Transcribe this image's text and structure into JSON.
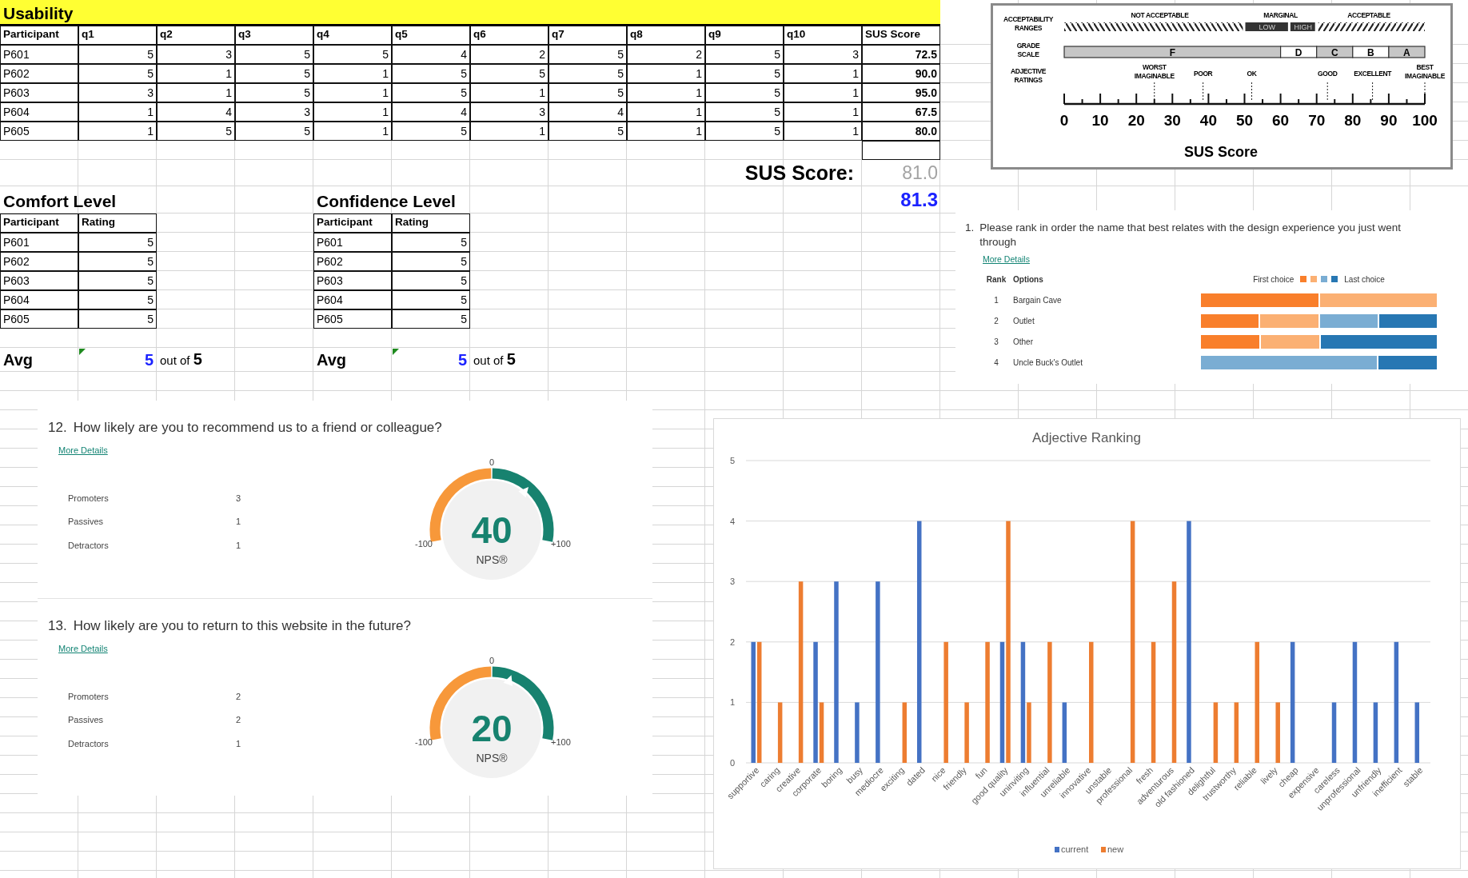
{
  "sheet": {
    "title": "Usability",
    "usability": {
      "columns": [
        "Participant",
        "q1",
        "q2",
        "q3",
        "q4",
        "q5",
        "q6",
        "q7",
        "q8",
        "q9",
        "q10",
        "SUS Score"
      ],
      "rows": [
        {
          "participant": "P601",
          "answers": [
            "5",
            "3",
            "5",
            "5",
            "4",
            "2",
            "5",
            "2",
            "5",
            "3"
          ],
          "sus": "72.5"
        },
        {
          "participant": "P602",
          "answers": [
            "5",
            "1",
            "5",
            "1",
            "5",
            "5",
            "5",
            "1",
            "5",
            "1"
          ],
          "sus": "90.0"
        },
        {
          "participant": "P603",
          "answers": [
            "3",
            "1",
            "5",
            "1",
            "5",
            "1",
            "5",
            "1",
            "5",
            "1"
          ],
          "sus": "95.0"
        },
        {
          "participant": "P604",
          "answers": [
            "1",
            "4",
            "3",
            "1",
            "4",
            "3",
            "4",
            "1",
            "5",
            "1"
          ],
          "sus": "67.5"
        },
        {
          "participant": "P605",
          "answers": [
            "1",
            "5",
            "5",
            "1",
            "5",
            "1",
            "5",
            "1",
            "5",
            "1"
          ],
          "sus": "80.0"
        }
      ]
    },
    "sus_summary": {
      "label": "SUS Score:",
      "raw": "81.0",
      "adjusted": "81.3"
    },
    "tables": [
      {
        "title": "Comfort Level",
        "columns": [
          "Participant",
          "Rating"
        ],
        "rows": [
          {
            "participant": "P601",
            "rating": "5"
          },
          {
            "participant": "P602",
            "rating": "5"
          },
          {
            "participant": "P603",
            "rating": "5"
          },
          {
            "participant": "P604",
            "rating": "5"
          },
          {
            "participant": "P605",
            "rating": "5"
          }
        ],
        "avg": {
          "label": "Avg",
          "value": "5",
          "suffix": "out of **5**"
        }
      },
      {
        "title": "Confidence Level",
        "columns": [
          "Participant",
          "Rating"
        ],
        "rows": [
          {
            "participant": "P601",
            "rating": "5"
          },
          {
            "participant": "P602",
            "rating": "5"
          },
          {
            "participant": "P603",
            "rating": "5"
          },
          {
            "participant": "P604",
            "rating": "5"
          },
          {
            "participant": "P605",
            "rating": "5"
          }
        ],
        "avg": {
          "label": "Avg",
          "value": "5",
          "suffix": "out of **5**"
        }
      }
    ]
  },
  "sus_scale": {
    "row_labels": [
      "ACCEPTABILITY RANGES",
      "GRADE SCALE",
      "ADJECTIVE RATINGS"
    ],
    "ranges": [
      "NOT ACCEPTABLE",
      "MARGINAL",
      "ACCEPTABLE"
    ],
    "marginal_parts": [
      "LOW",
      "HIGH"
    ],
    "grades": [
      "F",
      "D",
      "C",
      "B",
      "A"
    ],
    "adjectives": [
      "WORST IMAGINABLE",
      "POOR",
      "OK",
      "GOOD",
      "EXCELLENT",
      "BEST IMAGINABLE"
    ],
    "ticks": [
      "0",
      "10",
      "20",
      "30",
      "40",
      "50",
      "60",
      "70",
      "80",
      "90",
      "100"
    ],
    "axis_title": "SUS Score"
  },
  "ranking": {
    "number": "1.",
    "question": "Please rank in order the name that best relates with the design experience you just went through",
    "link": "More Details",
    "columns": [
      "Rank",
      "Options"
    ],
    "legend": {
      "first_label": "First choice",
      "last_label": "Last choice",
      "swatches": [
        {
          "color": "#f97f2b"
        },
        {
          "color": "#fbb073"
        },
        {
          "color": "#7aadd3"
        },
        {
          "color": "#2777b3"
        }
      ]
    },
    "options": [
      {
        "rank": "1",
        "name": "Bargain Cave"
      },
      {
        "rank": "2",
        "name": "Outlet"
      },
      {
        "rank": "3",
        "name": "Other"
      },
      {
        "rank": "4",
        "name": "Uncle Buck's Outlet"
      }
    ]
  },
  "nps": [
    {
      "number": "12.",
      "question": "How likely are you to recommend us to a friend or colleague?",
      "link": "More Details",
      "groups": [
        {
          "label": "Promoters",
          "count": "3"
        },
        {
          "label": "Passives",
          "count": "1"
        },
        {
          "label": "Detractors",
          "count": "1"
        }
      ],
      "score": "40",
      "score_label": "NPS®",
      "scale_min": "-100",
      "scale_zero": "0",
      "scale_max": "+100"
    },
    {
      "number": "13.",
      "question": "How likely are you to return to this website in the future?",
      "link": "More Details",
      "groups": [
        {
          "label": "Promoters",
          "count": "2"
        },
        {
          "label": "Passives",
          "count": "2"
        },
        {
          "label": "Detractors",
          "count": "1"
        }
      ],
      "score": "20",
      "score_label": "NPS®",
      "scale_min": "-100",
      "scale_zero": "0",
      "scale_max": "+100"
    }
  ],
  "adjective_chart": {
    "chart_data": {
      "type": "bar",
      "title": "Adjective Ranking",
      "categories": [
        "supportive",
        "caring",
        "creative",
        "corporate",
        "boring",
        "busy",
        "mediocre",
        "exciting",
        "dated",
        "nice",
        "friendly",
        "fun",
        "good quality",
        "uninviting",
        "influential",
        "unreliable",
        "innovative",
        "unstable",
        "professional",
        "fresh",
        "adventurous",
        "old fashioned",
        "delightful",
        "trustworthy",
        "reliable",
        "lively",
        "cheap",
        "expensive",
        "careless",
        "unprofessional",
        "unfriendly",
        "inefficient",
        "stable"
      ],
      "series": [
        {
          "name": "current",
          "color": "#4472c4",
          "values": [
            2,
            null,
            null,
            2,
            3,
            1,
            3,
            null,
            4,
            null,
            null,
            null,
            2,
            2,
            null,
            1,
            null,
            null,
            null,
            null,
            null,
            4,
            null,
            null,
            null,
            null,
            2,
            null,
            1,
            2,
            1,
            2,
            1
          ]
        },
        {
          "name": "new",
          "color": "#ed7d31",
          "values": [
            2,
            1,
            3,
            1,
            null,
            null,
            null,
            1,
            null,
            2,
            1,
            2,
            4,
            1,
            2,
            null,
            2,
            null,
            4,
            2,
            3,
            null,
            1,
            1,
            2,
            1,
            null,
            null,
            null,
            null,
            null,
            null,
            null
          ]
        }
      ],
      "ylim": [
        0,
        5
      ],
      "yticks": [
        {
          "value": 0,
          "label": "0"
        },
        {
          "value": 1,
          "label": "1"
        },
        {
          "value": 2,
          "label": "2"
        },
        {
          "value": 3,
          "label": "3"
        },
        {
          "value": 4,
          "label": "4"
        },
        {
          "value": 5,
          "label": "5"
        }
      ],
      "grid": true,
      "legend": true
    }
  }
}
